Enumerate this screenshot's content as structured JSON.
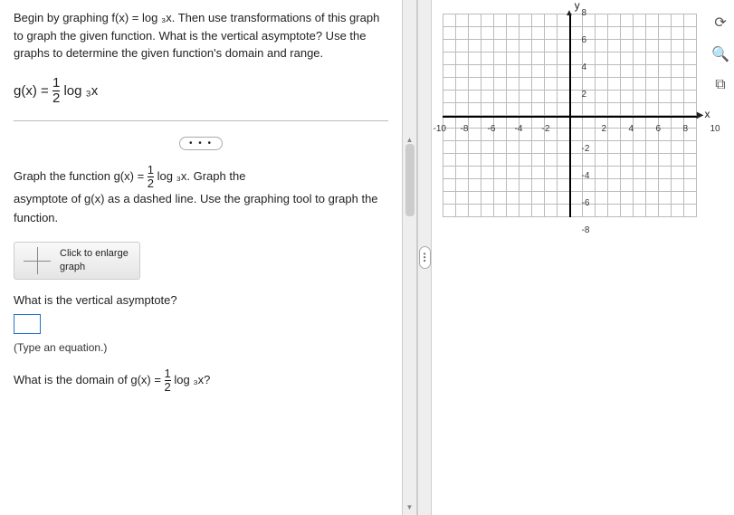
{
  "problem": {
    "intro": "Begin by graphing f(x) = log ₃x. Then use transformations of this graph to graph the given function. What is the vertical asymptote? Use the graphs to determine the given function's domain and range.",
    "equation_lhs": "g(x) = ",
    "equation_fraction_top": "1",
    "equation_fraction_bot": "2",
    "equation_rhs": " log ₃x"
  },
  "parts": {
    "a_prefix": "Graph the function g(x) = ",
    "a_frac_top": "1",
    "a_frac_bot": "2",
    "a_mid": " log ₃x. Graph the",
    "a_suffix": "asymptote of g(x) as a dashed line. Use the graphing tool to graph the function.",
    "graph_btn": "Click to enlarge graph",
    "b_question": "What is the vertical asymptote?",
    "b_hint": "(Type an equation.)",
    "c_prefix": "What is the domain of g(x) = ",
    "c_frac_top": "1",
    "c_frac_bot": "2",
    "c_suffix": " log ₃x?"
  },
  "graph": {
    "y_label": "y",
    "x_label": "x",
    "x_ticks": [
      "-10",
      "-8",
      "-6",
      "-4",
      "-2",
      "2",
      "4",
      "6",
      "8",
      "10"
    ],
    "y_ticks_pos": [
      "2",
      "4",
      "6",
      "8"
    ],
    "y_ticks_neg": [
      "-2",
      "-4",
      "-6",
      "-8"
    ]
  },
  "ellipsis": "• • •"
}
